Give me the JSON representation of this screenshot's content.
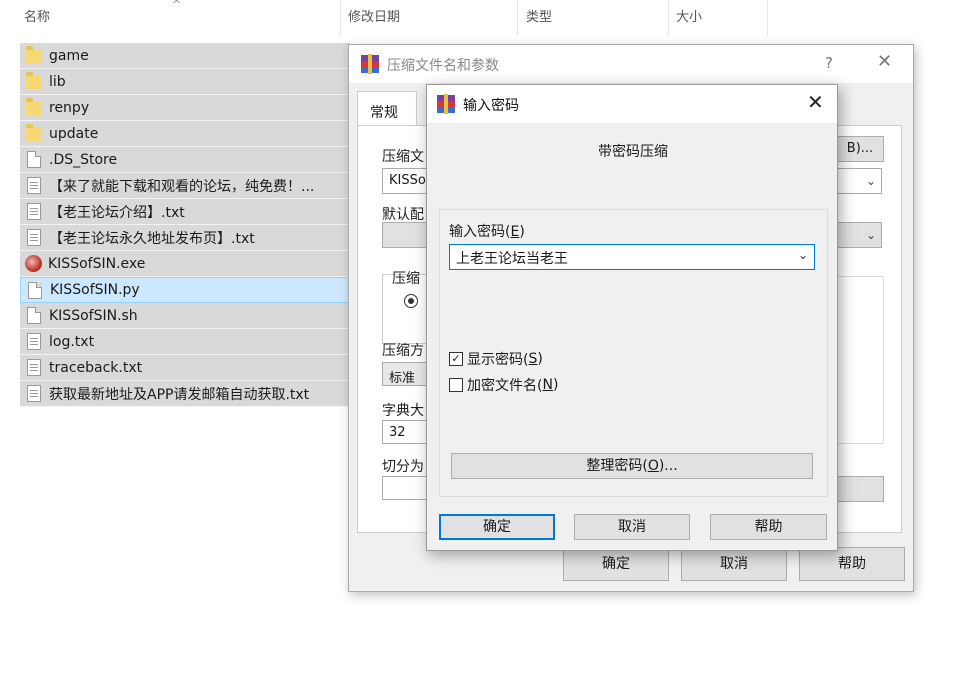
{
  "explorer": {
    "columns": {
      "name": "名称",
      "modified": "修改日期",
      "type": "类型",
      "size": "大小"
    },
    "files": [
      {
        "name": "game",
        "icon": "folder"
      },
      {
        "name": "lib",
        "icon": "folder"
      },
      {
        "name": "renpy",
        "icon": "folder"
      },
      {
        "name": "update",
        "icon": "folder"
      },
      {
        "name": ".DS_Store",
        "icon": "doc"
      },
      {
        "name": "【来了就能下载和观看的论坛，纯免费！...",
        "icon": "txt"
      },
      {
        "name": "【老王论坛介绍】.txt",
        "icon": "txt"
      },
      {
        "name": "【老王论坛永久地址发布页】.txt",
        "icon": "txt"
      },
      {
        "name": "KISSofSIN.exe",
        "icon": "exe"
      },
      {
        "name": "KISSofSIN.py",
        "icon": "doc",
        "selected": true
      },
      {
        "name": "KISSofSIN.sh",
        "icon": "doc"
      },
      {
        "name": "log.txt",
        "icon": "txt"
      },
      {
        "name": "traceback.txt",
        "icon": "txt"
      },
      {
        "name": "获取最新地址及APP请发邮箱自动获取.txt",
        "icon": "txt"
      }
    ]
  },
  "archive_dialog": {
    "title": "压缩文件名和参数",
    "help": "?",
    "close": "✕",
    "tab_general": "常规",
    "archive_name_label": "压缩文",
    "archive_name_value": "KISSof",
    "browse_label": "B)...",
    "default_profile_label": "默认配",
    "format_label": "压缩",
    "method_label": "压缩方",
    "method_value": "标准",
    "dict_label": "字典大",
    "dict_value": "32",
    "split_label": "切分为",
    "ok": "确定",
    "cancel": "取消",
    "help_btn": "帮助"
  },
  "password_dialog": {
    "title": "输入密码",
    "close": "✕",
    "heading": "带密码压缩",
    "password_label": "输入密码(",
    "password_label_key": "E",
    "password_label_end": ")",
    "password_value": "上老王论坛当老王",
    "show_password_label": "显示密码(",
    "show_password_key": "S",
    "show_password_checked": true,
    "encrypt_names_label": "加密文件名(",
    "encrypt_names_key": "N",
    "encrypt_names_checked": false,
    "organize_label": "整理密码(",
    "organize_key": "O",
    "organize_end": ")...",
    "ok": "确定",
    "cancel": "取消",
    "help": "帮助"
  }
}
